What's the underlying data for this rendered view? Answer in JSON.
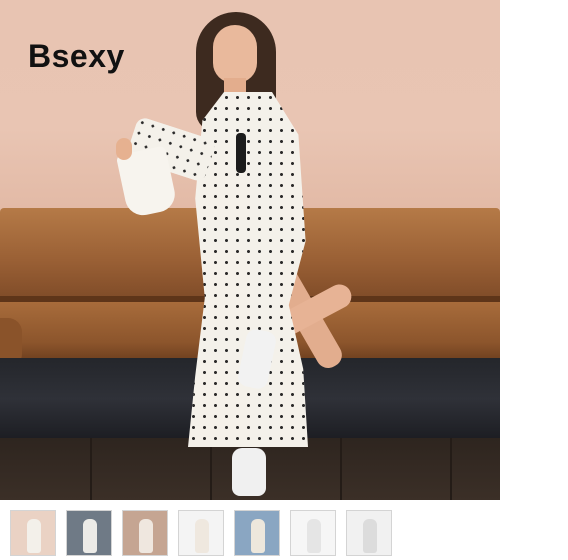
{
  "brand": {
    "logo_text": "Bsexy"
  },
  "main_image": {
    "icon": "product-photo-polka-dot-dress"
  },
  "thumbnails": [
    {
      "icon": "thumb-polka-dot-dress-sofa",
      "bg": "#ead2c4",
      "fig": "#f3f0ea"
    },
    {
      "icon": "thumb-white-dress-outdoor",
      "bg": "#6f7a86",
      "fig": "#ecebe7"
    },
    {
      "icon": "thumb-floral-dress-garden",
      "bg": "#c5a592",
      "fig": "#efe7df"
    },
    {
      "icon": "thumb-white-dress-studio",
      "bg": "#f4f4f4",
      "fig": "#efe8df"
    },
    {
      "icon": "thumb-boho-dress-pair",
      "bg": "#8aa6c2",
      "fig": "#ede7dc"
    },
    {
      "icon": "thumb-white-dress-flatlay",
      "bg": "#f6f6f6",
      "fig": "#e5e5e5"
    },
    {
      "icon": "thumb-lace-dress-detail",
      "bg": "#f1f1f1",
      "fig": "#dcdcdc"
    }
  ]
}
